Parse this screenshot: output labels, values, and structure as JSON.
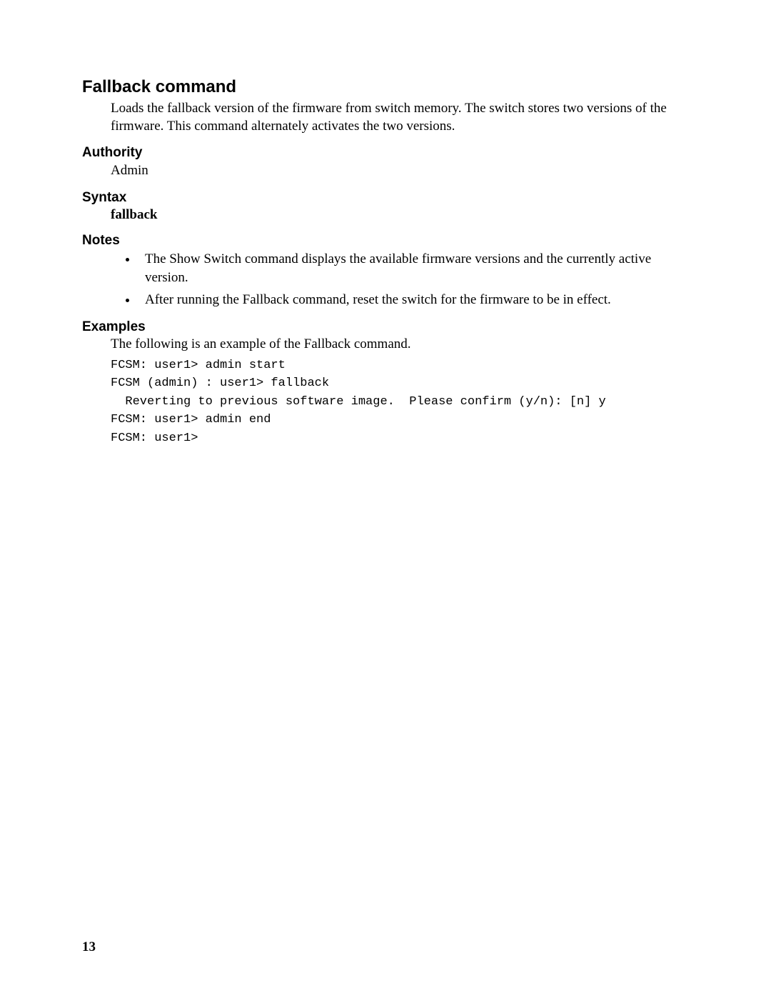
{
  "title": "Fallback command",
  "intro": "Loads the fallback version of the firmware from switch memory. The switch stores two versions of the firmware. This command alternately activates the two versions.",
  "sections": {
    "authority": {
      "heading": "Authority",
      "body": "Admin"
    },
    "syntax": {
      "heading": "Syntax",
      "body": "fallback"
    },
    "notes": {
      "heading": "Notes",
      "items": [
        "The Show Switch command displays the available firmware versions and the currently active version.",
        "After running the Fallback command, reset the switch for the firmware to be in effect."
      ]
    },
    "examples": {
      "heading": "Examples",
      "intro": "The following is an example of the Fallback command.",
      "code": "FCSM: user1> admin start\nFCSM (admin) : user1> fallback\n  Reverting to previous software image.  Please confirm (y/n): [n] y\nFCSM: user1> admin end\nFCSM: user1>"
    }
  },
  "pageNumber": "13"
}
